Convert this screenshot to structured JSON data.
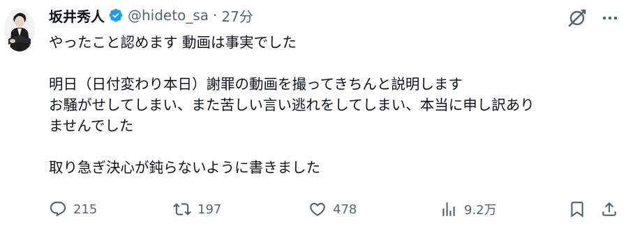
{
  "author": {
    "display_name": "坂井秀人",
    "handle": "@hideto_sa",
    "separator": "·",
    "time": "27分"
  },
  "post": {
    "lines": [
      "やったこと認めます 動画は事実でした",
      "",
      "明日（日付変わり本日）謝罪の動画を撮ってきちんと説明します",
      "お騒がせしてしまい、また苦しい言い逃れをしてしまい、本当に申し訳あり",
      "ませんでした",
      "",
      "取り急ぎ決心が鈍らないように書きました"
    ]
  },
  "actions": {
    "reply_count": "215",
    "retweet_count": "197",
    "like_count": "478",
    "view_count": "9.2万"
  },
  "colors": {
    "verified": "#1d9bf0",
    "muted": "#536471",
    "text": "#0f1419"
  },
  "icons": {
    "top": [
      "grok-icon",
      "more-icon"
    ],
    "actions": [
      "reply-icon",
      "retweet-icon",
      "like-icon",
      "views-icon",
      "bookmark-icon",
      "share-icon"
    ]
  }
}
